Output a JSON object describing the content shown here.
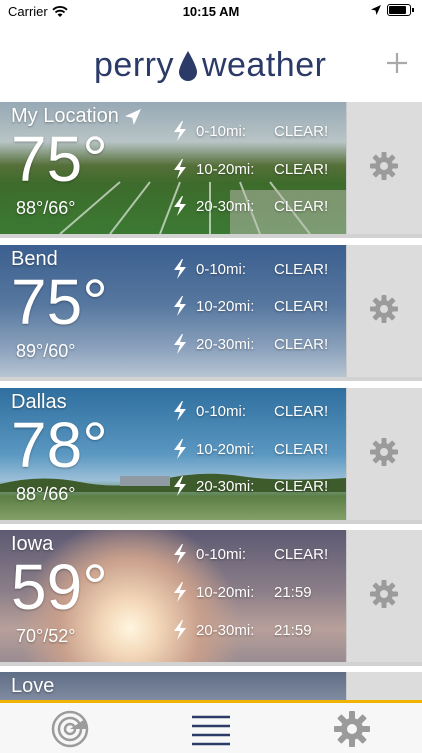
{
  "status_bar": {
    "carrier": "Carrier",
    "time": "10:15 AM"
  },
  "header": {
    "logo_left": "perry",
    "logo_right": "weather",
    "add_icon": "plus-icon"
  },
  "locations": [
    {
      "name": "My Location",
      "temp": "75°",
      "hilo": "88°/66°",
      "ranges": [
        {
          "distance": "0-10mi:",
          "status": "CLEAR!"
        },
        {
          "distance": "10-20mi:",
          "status": "CLEAR!"
        },
        {
          "distance": "20-30mi:",
          "status": "CLEAR!"
        }
      ]
    },
    {
      "name": "Bend",
      "temp": "75°",
      "hilo": "89°/60°",
      "ranges": [
        {
          "distance": "0-10mi:",
          "status": "CLEAR!"
        },
        {
          "distance": "10-20mi:",
          "status": "CLEAR!"
        },
        {
          "distance": "20-30mi:",
          "status": "CLEAR!"
        }
      ]
    },
    {
      "name": "Dallas",
      "temp": "78°",
      "hilo": "88°/66°",
      "ranges": [
        {
          "distance": "0-10mi:",
          "status": "CLEAR!"
        },
        {
          "distance": "10-20mi:",
          "status": "CLEAR!"
        },
        {
          "distance": "20-30mi:",
          "status": "CLEAR!"
        }
      ]
    },
    {
      "name": "Iowa",
      "temp": "59°",
      "hilo": "70°/52°",
      "ranges": [
        {
          "distance": "0-10mi:",
          "status": "CLEAR!"
        },
        {
          "distance": "10-20mi:",
          "status": "21:59"
        },
        {
          "distance": "20-30mi:",
          "status": "21:59"
        }
      ]
    },
    {
      "name": "Love"
    }
  ],
  "tab_bar": {
    "tabs": [
      "radar-icon",
      "list-menu-icon",
      "settings-gear-icon"
    ],
    "active_color": "#2b3a67",
    "accent": "#f0b400"
  }
}
